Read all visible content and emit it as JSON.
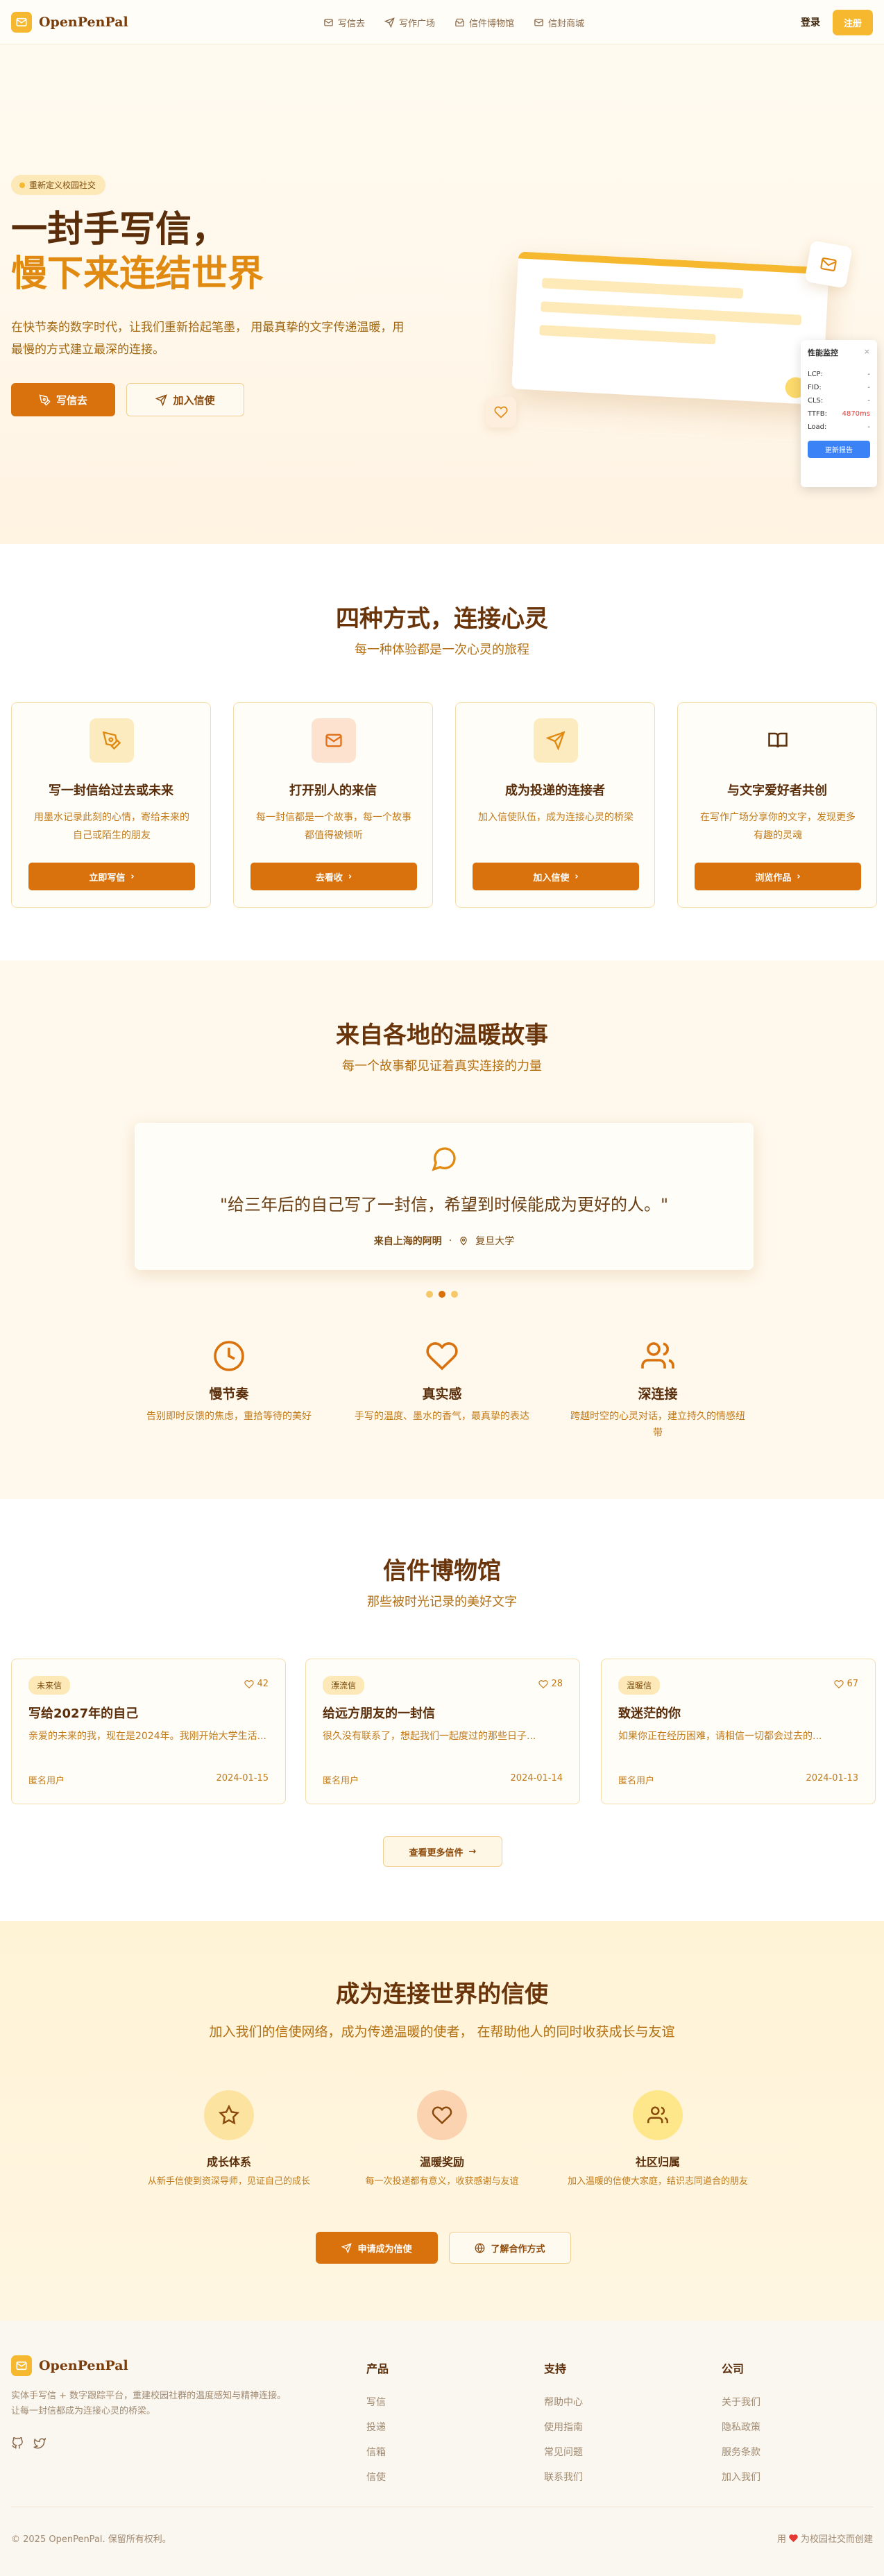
{
  "nav": {
    "brand": "OpenPenPal",
    "links": [
      {
        "label": "写信去",
        "icon": "mail-icon"
      },
      {
        "label": "写作广场",
        "icon": "send-icon"
      },
      {
        "label": "信件博物馆",
        "icon": "archive-icon"
      },
      {
        "label": "信封商城",
        "icon": "mail-icon"
      }
    ],
    "login": "登录",
    "register": "注册"
  },
  "hero": {
    "badge": "重新定义校园社交",
    "title_line1": "一封手写信，",
    "title_line2": "慢下来连结世界",
    "subtitle": "在快节奏的数字时代，让我们重新拾起笔墨， 用最真挚的文字传递温暖，用最慢的方式建立最深的连接。",
    "primary_cta": "写信去",
    "secondary_cta": "加入信使"
  },
  "perf_monitor": {
    "title": "性能监控",
    "close": "×",
    "rows": [
      {
        "label": "LCP:",
        "value": "-"
      },
      {
        "label": "FID:",
        "value": "-"
      },
      {
        "label": "CLS:",
        "value": "-"
      },
      {
        "label": "TTFB:",
        "value": "4870ms"
      },
      {
        "label": "Load:",
        "value": "-"
      }
    ],
    "button": "更新报告"
  },
  "features": {
    "title": "四种方式，连接心灵",
    "subtitle": "每一种体验都是一次心灵的旅程",
    "cards": [
      {
        "icon": "pen-icon",
        "title": "写一封信给过去或未来",
        "desc": "用墨水记录此刻的心情，寄给未来的自己或陌生的朋友",
        "button": "立即写信"
      },
      {
        "icon": "mail-icon",
        "title": "打开别人的来信",
        "desc": "每一封信都是一个故事，每一个故事都值得被倾听",
        "button": "去看收"
      },
      {
        "icon": "send-icon",
        "title": "成为投递的连接者",
        "desc": "加入信使队伍，成为连接心灵的桥梁",
        "button": "加入信使"
      },
      {
        "icon": "book-icon",
        "title": "与文字爱好者共创",
        "desc": "在写作广场分享你的文字，发现更多有趣的灵魂",
        "button": "浏览作品"
      }
    ]
  },
  "stories": {
    "title": "来自各地的温暖故事",
    "subtitle": "每一个故事都见证着真实连接的力量",
    "quote": "\"给三年后的自己写了一封信，希望到时候能成为更好的人。\"",
    "from": "来自上海的阿明",
    "location": "复旦大学",
    "values": [
      {
        "icon": "clock-icon",
        "title": "慢节奏",
        "desc": "告别即时反馈的焦虑，重拾等待的美好"
      },
      {
        "icon": "heart-icon",
        "title": "真实感",
        "desc": "手写的温度、墨水的香气，最真挚的表达"
      },
      {
        "icon": "users-icon",
        "title": "深连接",
        "desc": "跨越时空的心灵对话，建立持久的情感纽带"
      }
    ]
  },
  "museum": {
    "title": "信件博物馆",
    "subtitle": "那些被时光记录的美好文字",
    "letters": [
      {
        "tag": "未来信",
        "likes": "42",
        "title": "写给2027年的自己",
        "excerpt": "亲爱的未来的我，现在是2024年。我刚开始大学生活...",
        "author": "匿名用户",
        "date": "2024-01-15"
      },
      {
        "tag": "漂流信",
        "likes": "28",
        "title": "给远方朋友的一封信",
        "excerpt": "很久没有联系了，想起我们一起度过的那些日子...",
        "author": "匿名用户",
        "date": "2024-01-14"
      },
      {
        "tag": "温暖信",
        "likes": "67",
        "title": "致迷茫的你",
        "excerpt": "如果你正在经历困难，请相信一切都会过去的...",
        "author": "匿名用户",
        "date": "2024-01-13"
      }
    ],
    "more": "查看更多信件"
  },
  "messenger": {
    "title": "成为连接世界的信使",
    "desc": "加入我们的信使网络，成为传递温暖的使者， 在帮助他人的同时收获成长与友谊",
    "benefits": [
      {
        "icon": "star-icon",
        "title": "成长体系",
        "desc": "从新手信使到资深导师，见证自己的成长"
      },
      {
        "icon": "heart-icon",
        "title": "温暖奖励",
        "desc": "每一次投递都有意义，收获感谢与友谊"
      },
      {
        "icon": "users-icon",
        "title": "社区归属",
        "desc": "加入温暖的信使大家庭，结识志同道合的朋友"
      }
    ],
    "apply": "申请成为信使",
    "coop": "了解合作方式"
  },
  "footer": {
    "brand": "OpenPenPal",
    "desc": "实体手写信 + 数字跟踪平台，重建校园社群的温度感知与精神连接。让每一封信都成为连接心灵的桥梁。",
    "columns": [
      {
        "heading": "产品",
        "links": [
          "写信",
          "投递",
          "信箱",
          "信使"
        ]
      },
      {
        "heading": "支持",
        "links": [
          "帮助中心",
          "使用指南",
          "常见问题",
          "联系我们"
        ]
      },
      {
        "heading": "公司",
        "links": [
          "关于我们",
          "隐私政策",
          "服务条款",
          "加入我们"
        ]
      }
    ],
    "copyright": "© 2025 OpenPenPal. 保留所有权利。",
    "made_prefix": "用",
    "made_suffix": "为校园社交而创建"
  },
  "colors": {
    "accent": "#d9720c",
    "brand_yellow": "#f5b82e",
    "title_brown": "#5a2e0a",
    "text_amber": "#c27a18"
  }
}
